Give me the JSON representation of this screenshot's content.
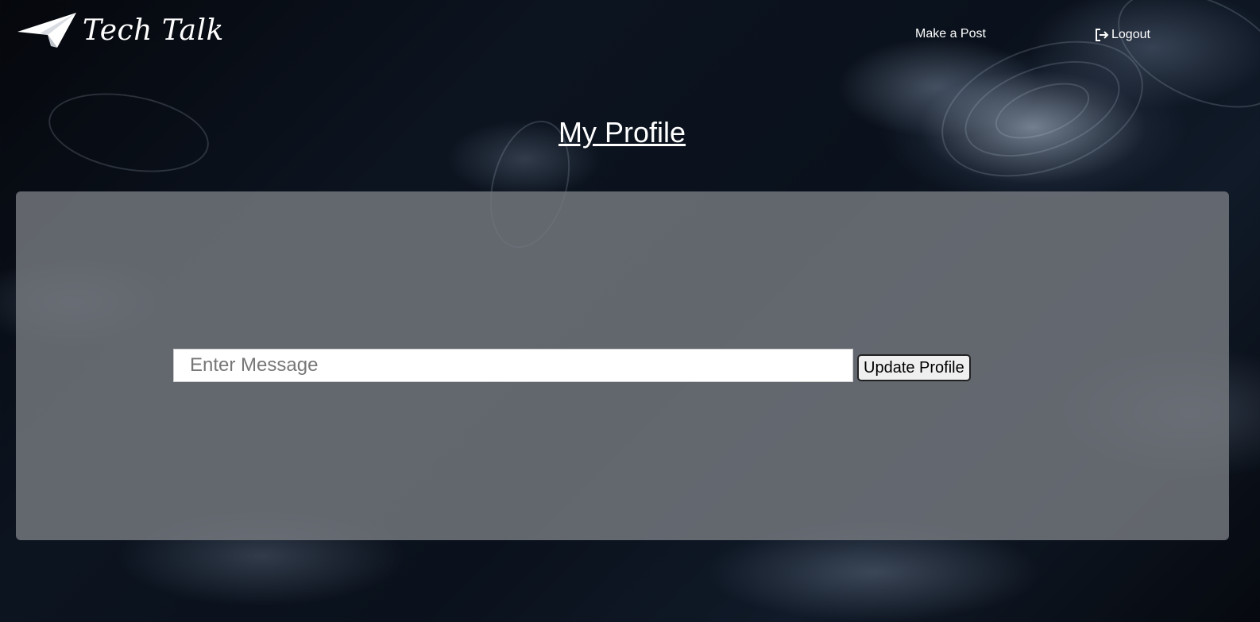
{
  "header": {
    "logo_text": "Tech Talk",
    "logo_icon": "paper-plane-icon",
    "nav": {
      "make_post": "Make a Post",
      "logout": "Logout",
      "logout_icon": "logout-icon"
    }
  },
  "main": {
    "title": "My Profile",
    "form": {
      "message_value": "",
      "message_placeholder": "Enter Message",
      "submit_label": "Update Profile"
    }
  },
  "colors": {
    "card_background": "#767a80",
    "text": "#ffffff",
    "input_background": "#ffffff"
  }
}
